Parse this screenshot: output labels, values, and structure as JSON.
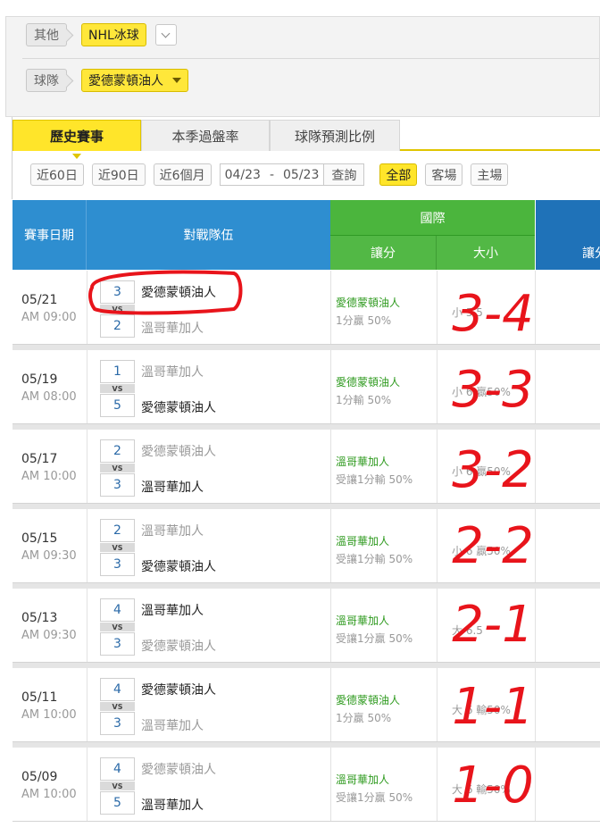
{
  "filters": {
    "row1_label": "其他",
    "league": "NHL冰球",
    "row2_label": "球隊",
    "team_selected": "愛德蒙頓油人"
  },
  "tabs": [
    {
      "label": "歷史賽事",
      "active": true
    },
    {
      "label": "本季過盤率",
      "active": false
    },
    {
      "label": "球隊預測比例",
      "active": false
    }
  ],
  "range": {
    "btn60": "近60日",
    "btn90": "近90日",
    "btn6m": "近6個月",
    "date_from": "04/23",
    "date_sep": "-",
    "date_to": "05/23",
    "query": "查詢",
    "all": "全部",
    "away": "客場",
    "home": "主場"
  },
  "table_header": {
    "date": "賽事日期",
    "teams": "對戰隊伍",
    "intl": "國際",
    "handicap": "讓分",
    "over_under": "大小",
    "handicap2": "讓分"
  },
  "matches": [
    {
      "date": "05/21",
      "time": "AM 09:00",
      "top_score": "3",
      "top_team": "愛德蒙頓油人",
      "top_win": true,
      "vs": "VS",
      "bottom_score": "2",
      "bottom_team": "溫哥華加人",
      "bottom_win": false,
      "hcp_team": "愛德蒙頓油人",
      "hcp_result": "1分贏 50%",
      "ou": "小 5.5"
    },
    {
      "date": "05/19",
      "time": "AM 08:00",
      "top_score": "1",
      "top_team": "溫哥華加人",
      "top_win": false,
      "vs": "VS",
      "bottom_score": "5",
      "bottom_team": "愛德蒙頓油人",
      "bottom_win": true,
      "hcp_team": "愛德蒙頓油人",
      "hcp_result": "1分輸 50%",
      "ou": "小 6 贏50%"
    },
    {
      "date": "05/17",
      "time": "AM 10:00",
      "top_score": "2",
      "top_team": "愛德蒙頓油人",
      "top_win": false,
      "vs": "VS",
      "bottom_score": "3",
      "bottom_team": "溫哥華加人",
      "bottom_win": true,
      "hcp_team": "溫哥華加人",
      "hcp_result": "受讓1分輸 50%",
      "ou": "小 6 贏50%"
    },
    {
      "date": "05/15",
      "time": "AM 09:30",
      "top_score": "2",
      "top_team": "溫哥華加人",
      "top_win": false,
      "vs": "VS",
      "bottom_score": "3",
      "bottom_team": "愛德蒙頓油人",
      "bottom_win": true,
      "hcp_team": "溫哥華加人",
      "hcp_result": "受讓1分輸 50%",
      "ou": "小 6 贏50%"
    },
    {
      "date": "05/13",
      "time": "AM 09:30",
      "top_score": "4",
      "top_team": "溫哥華加人",
      "top_win": true,
      "vs": "VS",
      "bottom_score": "3",
      "bottom_team": "愛德蒙頓油人",
      "bottom_win": false,
      "hcp_team": "溫哥華加人",
      "hcp_result": "受讓1分贏 50%",
      "ou": "大 6.5"
    },
    {
      "date": "05/11",
      "time": "AM 10:00",
      "top_score": "4",
      "top_team": "愛德蒙頓油人",
      "top_win": true,
      "vs": "VS",
      "bottom_score": "3",
      "bottom_team": "溫哥華加人",
      "bottom_win": false,
      "hcp_team": "愛德蒙頓油人",
      "hcp_result": "1分贏 50%",
      "ou": "大 6 輸50%"
    },
    {
      "date": "05/09",
      "time": "AM 10:00",
      "top_score": "4",
      "top_team": "愛德蒙頓油人",
      "top_win": false,
      "vs": "VS",
      "bottom_score": "5",
      "bottom_team": "溫哥華加人",
      "bottom_win": true,
      "hcp_team": "溫哥華加人",
      "hcp_result": "受讓1分贏 50%",
      "ou": "大 6 輸50%"
    }
  ],
  "annotations": [
    "3-4",
    "3-3",
    "3-2",
    "2-2",
    "2-1",
    "1-1",
    "1-0"
  ],
  "colors": {
    "accent_yellow": "#ffe52a",
    "header_blue": "#2e8ed0",
    "header_green": "#52b845",
    "annotation_red": "#e8141b"
  }
}
